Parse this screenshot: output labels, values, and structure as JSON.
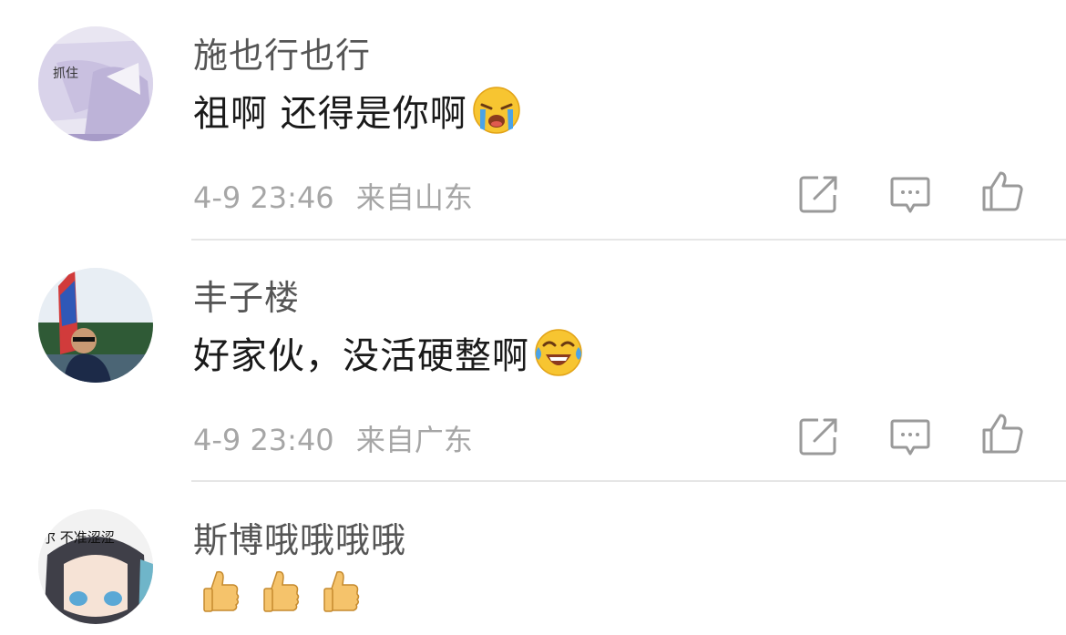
{
  "comments": [
    {
      "username": "施也行也行",
      "avatar_text": "抓住",
      "text": "祖啊 还得是你啊",
      "emoji": "crying-face",
      "time": "4-9 23:46",
      "location": "来自山东"
    },
    {
      "username": "丰子楼",
      "text": "好家伙，没活硬整啊",
      "emoji": "laughing-tears-face",
      "time": "4-9 23:40",
      "location": "来自广东"
    },
    {
      "username": "斯博哦哦哦哦",
      "avatar_text": "尔 不准涩涩",
      "emoji": "thumbs-up x3"
    }
  ],
  "icons": {
    "share": "share-icon",
    "comment": "comment-icon",
    "like": "like-icon"
  },
  "colors": {
    "username": "#555555",
    "meta": "#a6a6a6",
    "icon": "#9a9a9a",
    "divider": "#e6e6e6"
  }
}
